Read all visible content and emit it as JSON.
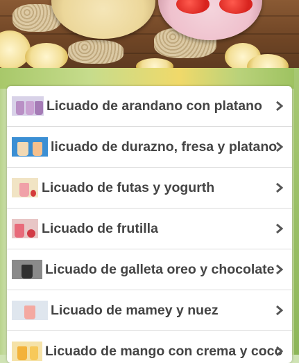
{
  "header_image": {
    "description_icon": "smoothie-photo-icon"
  },
  "list": {
    "items": [
      {
        "label": "Licuado de arandano con platano",
        "thumb_icon": "blueberry-smoothie-icon",
        "chevron_icon": "chevron-right-icon"
      },
      {
        "label": "licuado de durazno, fresa y platano",
        "thumb_icon": "peach-smoothie-icon",
        "chevron_icon": "chevron-right-icon"
      },
      {
        "label": "Licuado de futas y yogurth",
        "thumb_icon": "fruit-yogurt-smoothie-icon",
        "chevron_icon": "chevron-right-icon"
      },
      {
        "label": "Licuado de frutilla",
        "thumb_icon": "strawberry-smoothie-icon",
        "chevron_icon": "chevron-right-icon"
      },
      {
        "label": "Licuado de galleta oreo y chocolate",
        "thumb_icon": "oreo-shake-icon",
        "chevron_icon": "chevron-right-icon"
      },
      {
        "label": "Licuado de mamey y nuez",
        "thumb_icon": "mamey-smoothie-icon",
        "chevron_icon": "chevron-right-icon"
      },
      {
        "label": "Licuado de mango con crema y coco",
        "thumb_icon": "mango-smoothie-icon",
        "chevron_icon": "chevron-right-icon"
      }
    ]
  },
  "colors": {
    "label_text": "#444444",
    "chevron": "#555555",
    "divider": "#dcdcdc",
    "card_bg": "#ffffff"
  }
}
